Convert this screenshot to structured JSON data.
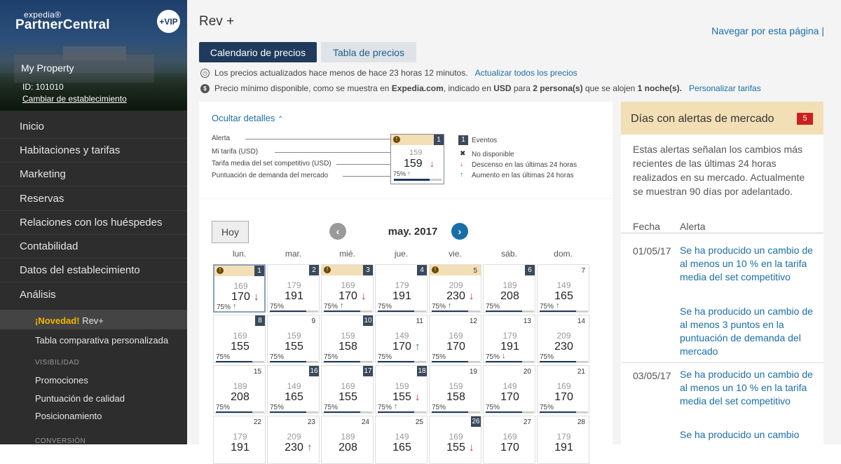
{
  "brand": {
    "small": "expedia®",
    "big": "PartnerCentral",
    "vip": "+VIP"
  },
  "property": {
    "name": "My Property",
    "id": "ID: 101010",
    "change": "Cambiar de establecimiento"
  },
  "nav": [
    "Inicio",
    "Habitaciones y tarifas",
    "Marketing",
    "Reservas",
    "Relaciones con los huéspedes",
    "Contabilidad",
    "Datos del establecimiento",
    "Análisis"
  ],
  "subnav": {
    "novedad": "¡Novedad!",
    "active": "Rev+",
    "tabla": "Tabla comparativa personalizada",
    "visibilidad": "VISIBILIDAD",
    "promociones": "Promociones",
    "calidad": "Puntuación de calidad",
    "posicionamiento": "Posicionamiento",
    "conversion": "CONVERSIÓN"
  },
  "page": {
    "title": "Rev +",
    "nav_link": "Navegar por esta página |"
  },
  "tabs": {
    "calendario": "Calendario de precios",
    "tabla": "Tabla de precios"
  },
  "info": {
    "updated": "Los precios actualizados hace menos de hace 23 horas 12 minutos.",
    "update_all": "Actualizar todos los precios",
    "min_price_a": "Precio mínimo disponible, como se muestra en ",
    "min_price_b": "Expedia.com",
    "min_price_c": ", indicado en ",
    "min_price_d": "USD",
    "min_price_e": " para ",
    "min_price_f": "2 persona(s)",
    "min_price_g": " que se alojen ",
    "min_price_h": "1 noche(s).",
    "customize": "Personalizar tarifas"
  },
  "legend": {
    "hide": "Ocultar detalles",
    "alerta": "Alerta",
    "mi_tarifa": "Mi tarifa (USD)",
    "media": "Tarifa media del set competitivo (USD)",
    "puntuacion": "Puntuación de demanda del mercado",
    "example_top": "159",
    "example_main": "159",
    "example_pct": "75%",
    "example_day": "1",
    "eventos_num": "1",
    "eventos": "Eventos",
    "no_disp": "No disponible",
    "descenso": "Descenso en las últimas 24 horas",
    "aumento": "Aumento en las últimas 24 horas"
  },
  "calendar": {
    "today": "Hoy",
    "month": "may. 2017",
    "weekdays": [
      "lun.",
      "mar.",
      "mié.",
      "jue.",
      "vie.",
      "sáb.",
      "dom."
    ],
    "days": [
      {
        "d": "1",
        "top": "169",
        "main": "170",
        "pct": "75%",
        "alert": true,
        "event": true,
        "arrow": "down",
        "parrow": "up"
      },
      {
        "d": "2",
        "top": "179",
        "main": "191",
        "pct": "75%",
        "alert": false,
        "event": true,
        "arrow": "",
        "parrow": ""
      },
      {
        "d": "3",
        "top": "169",
        "main": "170",
        "pct": "75%",
        "alert": true,
        "event": true,
        "arrow": "down",
        "parrow": "up"
      },
      {
        "d": "4",
        "top": "179",
        "main": "191",
        "pct": "75%",
        "alert": false,
        "event": true,
        "arrow": "",
        "parrow": ""
      },
      {
        "d": "5",
        "top": "209",
        "main": "230",
        "pct": "75%",
        "alert": true,
        "event": false,
        "arrow": "down",
        "parrow": "up"
      },
      {
        "d": "6",
        "top": "189",
        "main": "208",
        "pct": "75%",
        "alert": false,
        "event": true,
        "arrow": "",
        "parrow": ""
      },
      {
        "d": "7",
        "top": "149",
        "main": "165",
        "pct": "75%",
        "alert": false,
        "event": false,
        "arrow": "",
        "parrow": "up"
      },
      {
        "d": "8",
        "top": "169",
        "main": "155",
        "pct": "75%",
        "alert": false,
        "event": true,
        "arrow": "",
        "parrow": ""
      },
      {
        "d": "9",
        "top": "159",
        "main": "155",
        "pct": "75%",
        "alert": false,
        "event": false,
        "arrow": "",
        "parrow": ""
      },
      {
        "d": "10",
        "top": "159",
        "main": "158",
        "pct": "75%",
        "alert": false,
        "event": true,
        "arrow": "",
        "parrow": ""
      },
      {
        "d": "11",
        "top": "149",
        "main": "170",
        "pct": "75%",
        "alert": false,
        "event": false,
        "arrow": "up",
        "parrow": ""
      },
      {
        "d": "12",
        "top": "169",
        "main": "170",
        "pct": "75%",
        "alert": false,
        "event": false,
        "arrow": "",
        "parrow": ""
      },
      {
        "d": "13",
        "top": "179",
        "main": "191",
        "pct": "75%",
        "alert": false,
        "event": false,
        "arrow": "",
        "parrow": "down"
      },
      {
        "d": "14",
        "top": "209",
        "main": "230",
        "pct": "75%",
        "alert": false,
        "event": false,
        "arrow": "",
        "parrow": ""
      },
      {
        "d": "15",
        "top": "189",
        "main": "208",
        "pct": "75%",
        "alert": false,
        "event": false,
        "arrow": "",
        "parrow": ""
      },
      {
        "d": "16",
        "top": "149",
        "main": "165",
        "pct": "75%",
        "alert": false,
        "event": true,
        "arrow": "",
        "parrow": ""
      },
      {
        "d": "17",
        "top": "169",
        "main": "155",
        "pct": "75%",
        "alert": false,
        "event": true,
        "arrow": "",
        "parrow": ""
      },
      {
        "d": "18",
        "top": "159",
        "main": "155",
        "pct": "75%",
        "alert": false,
        "event": true,
        "arrow": "down",
        "parrow": "up"
      },
      {
        "d": "19",
        "top": "159",
        "main": "158",
        "pct": "75%",
        "alert": false,
        "event": false,
        "arrow": "",
        "parrow": ""
      },
      {
        "d": "20",
        "top": "149",
        "main": "170",
        "pct": "75%",
        "alert": false,
        "event": false,
        "arrow": "",
        "parrow": ""
      },
      {
        "d": "21",
        "top": "169",
        "main": "170",
        "pct": "75%",
        "alert": false,
        "event": false,
        "arrow": "",
        "parrow": ""
      },
      {
        "d": "22",
        "top": "179",
        "main": "191",
        "pct": "",
        "alert": false,
        "event": false,
        "arrow": "",
        "parrow": ""
      },
      {
        "d": "23",
        "top": "209",
        "main": "230",
        "pct": "",
        "alert": false,
        "event": false,
        "arrow": "up",
        "parrow": ""
      },
      {
        "d": "24",
        "top": "189",
        "main": "208",
        "pct": "",
        "alert": false,
        "event": false,
        "arrow": "",
        "parrow": ""
      },
      {
        "d": "25",
        "top": "149",
        "main": "165",
        "pct": "",
        "alert": false,
        "event": false,
        "arrow": "",
        "parrow": ""
      },
      {
        "d": "26",
        "top": "169",
        "main": "155",
        "pct": "",
        "alert": false,
        "event": true,
        "arrow": "down",
        "parrow": ""
      },
      {
        "d": "27",
        "top": "169",
        "main": "170",
        "pct": "",
        "alert": false,
        "event": false,
        "arrow": "",
        "parrow": ""
      },
      {
        "d": "28",
        "top": "179",
        "main": "191",
        "pct": "",
        "alert": false,
        "event": false,
        "arrow": "",
        "parrow": ""
      }
    ]
  },
  "alerts": {
    "title": "Días con alertas de mercado",
    "count": "5",
    "desc": "Estas alertas señalan los cambios más recientes de las últimas 24 horas realizados en su mercado. Actualmente se muestran 90 días por adelantado.",
    "col_fecha": "Fecha",
    "col_alerta": "Alerta",
    "rows": [
      {
        "date": "01/05/17",
        "items": [
          "Se ha producido un cambio de al menos un 10 % en la tarifa media del set competitivo",
          "Se ha producido un cambio de al menos 3 puntos en la puntuación de demanda del mercado"
        ]
      },
      {
        "date": "03/05/17",
        "items": [
          "Se ha producido un cambio de al menos un 10 % en la tarifa media del set competitivo",
          "Se ha producido un cambio"
        ]
      }
    ]
  },
  "colors": {
    "accent": "#1a6ea8",
    "dark_tab": "#1f3a5c",
    "alert_bg": "#f3dfb6",
    "badge_red": "#cc1f1f",
    "event_box": "#3a4a5c",
    "up": "#2e7d32",
    "down": "#c62828",
    "bar": "#1f3a5c"
  }
}
